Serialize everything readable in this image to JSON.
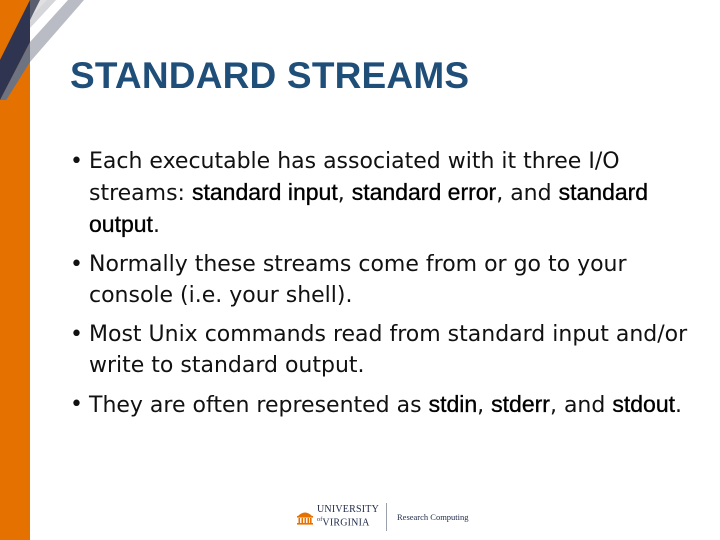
{
  "slide": {
    "title": "STANDARD STREAMS"
  },
  "bullets": [
    [
      {
        "text": "Each executable has associated with it three I/O streams: ",
        "bold": false
      },
      {
        "text": "standard input",
        "bold": true
      },
      {
        "text": ", ",
        "bold": false
      },
      {
        "text": "standard error",
        "bold": true
      },
      {
        "text": ", and ",
        "bold": false
      },
      {
        "text": "standard output",
        "bold": true
      },
      {
        "text": ".",
        "bold": false
      }
    ],
    [
      {
        "text": "Normally these streams come from or go to your console (i.e. your shell).",
        "bold": false
      }
    ],
    [
      {
        "text": "Most Unix commands read from standard input and/or write to standard output.",
        "bold": false
      }
    ],
    [
      {
        "text": "They are often represented as ",
        "bold": false
      },
      {
        "text": "stdin",
        "bold": true
      },
      {
        "text": ", ",
        "bold": false
      },
      {
        "text": "stderr",
        "bold": true
      },
      {
        "text": ", and ",
        "bold": false
      },
      {
        "text": "stdout",
        "bold": true
      },
      {
        "text": ".",
        "bold": false
      }
    ]
  ],
  "bullet_marker": "•",
  "footer": {
    "logo_line1": "UNIVERSITY",
    "logo_line2": "VIRGINIA",
    "logo_of": "of",
    "unit_name": "Research Computing"
  },
  "colors": {
    "accent_orange": "#e57200",
    "title_blue": "#1f4e79",
    "navy": "#232d4b"
  },
  "icons": {
    "logo": "rotunda-icon",
    "corner": "diagonal-stripes-decoration"
  }
}
